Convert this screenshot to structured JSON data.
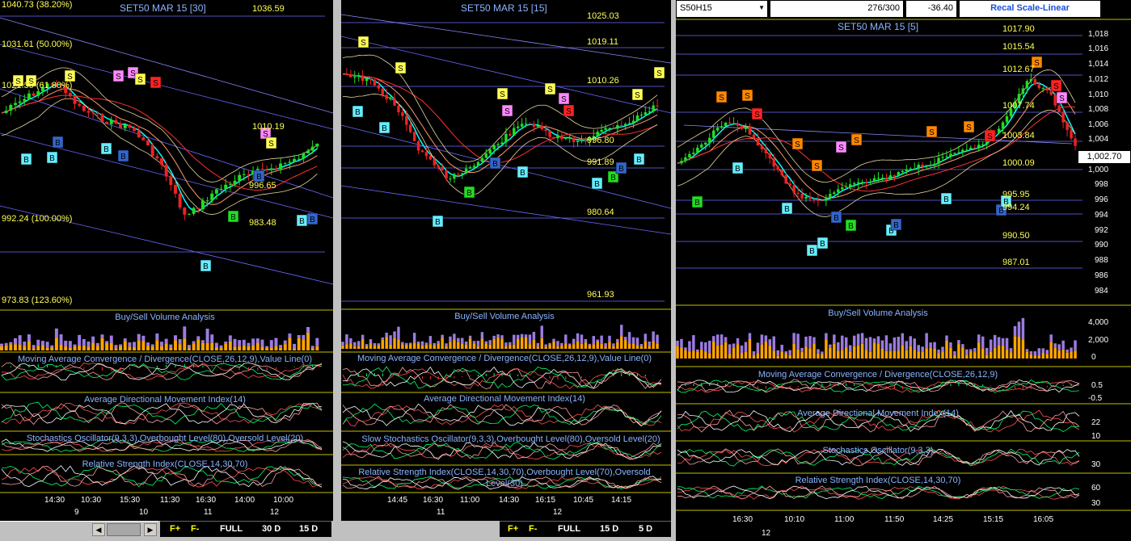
{
  "panels": [
    {
      "id": "p1",
      "title": "SET50 MAR 15 [30]",
      "width": 412,
      "tool_items": [
        "F+",
        "F-",
        "FULL",
        "30 D",
        "15 D"
      ],
      "levels": [
        "1040.73 (38.20%)",
        "1036.59",
        "1031.61 (50.00%)",
        "1021.30 (61.80%)",
        "1010.19",
        "996.65",
        "992.24 (100.00%)",
        "983.48",
        "973.83 (123.60%)"
      ],
      "subtitles": [
        "Buy/Sell Volume Analysis",
        "Moving Average Convergence / Divergence(CLOSE,26,12,9),Value Line(0)",
        "Average Directional Movement Index(14)",
        "Stochastics Oscillator(9,3,3),Overbought Level(80),Oversold Level(20)",
        "Relative Strength Index(CLOSE,14,30,70)"
      ],
      "times": [
        "14:30",
        "10:30",
        "15:30",
        "11:30",
        "16:30",
        "14:00",
        "10:00"
      ],
      "dates": [
        "9",
        "10",
        "11",
        "12"
      ]
    },
    {
      "id": "p2",
      "title": "SET50 MAR 15 [15]",
      "width": 408,
      "tool_items": [
        "F+",
        "F-",
        "FULL",
        "15 D",
        "5 D"
      ],
      "levels": [
        "1025.03",
        "1019.11",
        "1010.26",
        "996.80",
        "991.89",
        "980.64",
        "961.93"
      ],
      "subtitles": [
        "Buy/Sell Volume Analysis",
        "Moving Average Convergence / Divergence(CLOSE,26,12,9),Value Line(0)",
        "Average Directional Movement Index(14)",
        "Slow Stochastics Oscillator(9,3,3),Overbought Level(80),Oversold Level(20)",
        "Relative Strength Index(CLOSE,14,30,70),Overbought Level(70),Oversold Level(30)"
      ],
      "times": [
        "14:45",
        "16:30",
        "11:00",
        "14:30",
        "16:15",
        "10:45",
        "14:15"
      ],
      "dates": [
        "11",
        "12"
      ]
    },
    {
      "id": "p3",
      "title": "SET50 MAR 15 [5]",
      "width": 562,
      "symbol": "S50H15",
      "counter": "276/300",
      "change": "-36.40",
      "recal": "Recal Scale-Linear",
      "price_tag": "1,002.70",
      "levels": [
        "1017.90",
        "1015.54",
        "1012.67",
        "1007.74",
        "1003.84",
        "1000.09",
        "995.95",
        "994.24",
        "990.50",
        "987.01"
      ],
      "yaxis": [
        "1,018",
        "1,016",
        "1,014",
        "1,012",
        "1,010",
        "1,008",
        "1,006",
        "1,004",
        "1,002",
        "1,000",
        "998",
        "996",
        "994",
        "992",
        "990",
        "988",
        "986",
        "984"
      ],
      "vol_axis": [
        "4,000",
        "2,000",
        "0"
      ],
      "macd_axis": [
        "0.5",
        "-0.5"
      ],
      "adx_axis": [
        "22",
        "10"
      ],
      "stoch_axis": [
        "30"
      ],
      "rsi_axis": [
        "60",
        "30"
      ],
      "subtitles": [
        "Buy/Sell Volume Analysis",
        "Moving Average Convergence / Divergence(CLOSE,26,12,9)",
        "Average Directional Movement Index(14)",
        "Stochastics Oscillator(9,3,3)",
        "Relative Strength Index(CLOSE,14,30,70)"
      ],
      "times": [
        "16:30",
        "10:10",
        "11:00",
        "11:50",
        "14:25",
        "15:15",
        "16:05"
      ],
      "dates": [
        "12"
      ]
    }
  ],
  "signals": {
    "buy": "B",
    "sell": "S"
  },
  "colors": {
    "background": "#000000",
    "price_line": "#ffff00",
    "title_text": "#8ab4ff",
    "bull_candle": "#22dd22",
    "bear_candle": "#ee2222",
    "volume_buy": "#ffa500",
    "volume_sell": "#9b7be0"
  }
}
